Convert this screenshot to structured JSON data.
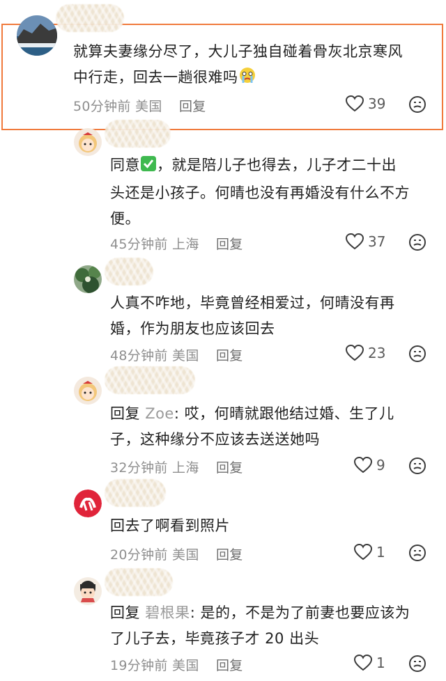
{
  "comments": [
    {
      "text": "就算夫妻缘分尽了，大儿子独自碰着骨灰北京寒风中行走，回去一趟很难吗",
      "line1": "就算夫妻缘分尽了，大儿子独自碰着骨灰北京寒风",
      "line2": "中行走，回去一趟很难吗",
      "time": "50分钟前",
      "location": "美国",
      "reply_label": "回复",
      "likes": "39"
    },
    {
      "line1": "同意",
      "line1b": "，就是陪儿子也得去，儿子才二十出",
      "line2": "头还是小孩子。何晴也没有再婚没有什么不方",
      "line3": "便。",
      "time": "45分钟前",
      "location": "上海",
      "reply_label": "回复",
      "likes": "37"
    },
    {
      "line1": "人真不咋地，毕竟曾经相爱过，何晴没有再",
      "line2": "婚，作为朋友也应该回去",
      "time": "48分钟前",
      "location": "美国",
      "reply_label": "回复",
      "likes": "23"
    },
    {
      "reply_prefix": "回复",
      "reply_to": "Zoe",
      "line1": ": 哎，何晴就跟他结过婚、生了儿",
      "line2": "子，这种缘分不应该去送送她吗",
      "time": "32分钟前",
      "location": "上海",
      "reply_label": "回复",
      "likes": "9"
    },
    {
      "line1": "回去了啊看到照片",
      "time": "20分钟前",
      "location": "美国",
      "reply_label": "回复",
      "likes": "1"
    },
    {
      "reply_prefix": "回复",
      "reply_to": "碧根果",
      "line1": ": 是的，不是为了前妻也要应该为",
      "line2": "了儿子去，毕竟孩子才 20 出头",
      "time": "19分钟前",
      "location": "美国",
      "reply_label": "回复",
      "likes": "1"
    }
  ],
  "colors": {
    "highlight": "#f07a3c",
    "checkmark": "#3fb94f",
    "meta_gray": "#8e8e8e"
  },
  "icons": [
    "heart-icon",
    "dislike-face-icon",
    "check-mark-emoji",
    "crying-face-emoji"
  ]
}
